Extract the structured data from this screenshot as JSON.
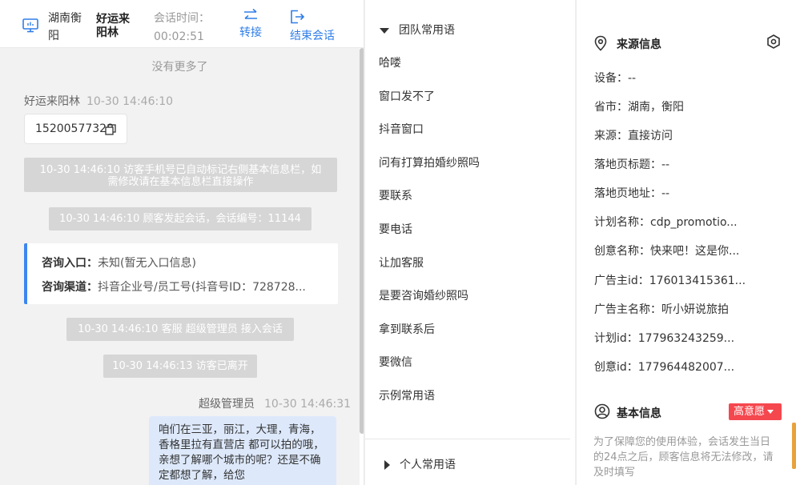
{
  "header": {
    "location": "湖南衡阳",
    "visitor_name": "好运来阳林",
    "session_time_label": "会话时间：",
    "session_time": "00:02:51",
    "transfer_label": "转接",
    "end_label": "结束会话"
  },
  "chat": {
    "no_more": "没有更多了",
    "visitor_msg": {
      "sender": "好运来阳林",
      "time": "10-30 14:46:10",
      "text": "15200577328"
    },
    "sys_tip_1": "10-30 14:46:10 访客手机号已自动标记右侧基本信息栏，如需修改请在基本信息栏直接操作",
    "sys_tip_2": "10-30 14:46:10 顾客发起会话，会话编号：11144",
    "consult": {
      "entry_label": "咨询入口：",
      "entry_value": "未知(暂无入口信息)",
      "channel_label": "咨询渠道：",
      "channel_value": "抖音企业号/员工号(抖音号ID：728728..."
    },
    "sys_tip_3": "10-30 14:46:10 客服 超级管理员 接入会话",
    "sys_tip_4": "10-30 14:46:13 访客已离开",
    "agent_msg": {
      "sender": "超级管理员",
      "time": "10-30 14:46:31",
      "text": "咱们在三亚，丽江，大理，青海， 香格里拉有直营店 都可以拍的哦，亲想了解哪个城市的呢？还是不确定都想了解，给您"
    }
  },
  "quick_replies": {
    "team_group_label": "团队常用语",
    "team_items": [
      "哈喽",
      "窗口发不了",
      "抖音窗口",
      "问有打算拍婚纱照吗",
      "要联系",
      "要电话",
      "让加客服",
      "是要咨询婚纱照吗",
      "拿到联系后",
      "要微信",
      "示例常用语"
    ],
    "personal_group_label": "个人常用语"
  },
  "source_info": {
    "title": "来源信息",
    "rows": [
      "设备：--",
      "省市：湖南，衡阳",
      "来源：直接访问",
      "落地页标题：--",
      "落地页地址：--",
      "计划名称：cdp_promotio...",
      "创意名称：快来吧！这是你...",
      "广告主id：176013415361...",
      "广告主名称：听小妍说旅拍",
      "计划id：177963243259...",
      "创意id：177964482007..."
    ]
  },
  "basic_info": {
    "title": "基本信息",
    "intent_tag": "高意愿",
    "notice": "为了保障您的使用体验，会话发生当日的24点之后，顾客信息将无法修改，请及时填写"
  },
  "colors": {
    "accent": "#2f7ee8",
    "tag_red": "#f5474e",
    "bubble_blue": "#dde9fb",
    "card_border": "#3d86f0"
  }
}
